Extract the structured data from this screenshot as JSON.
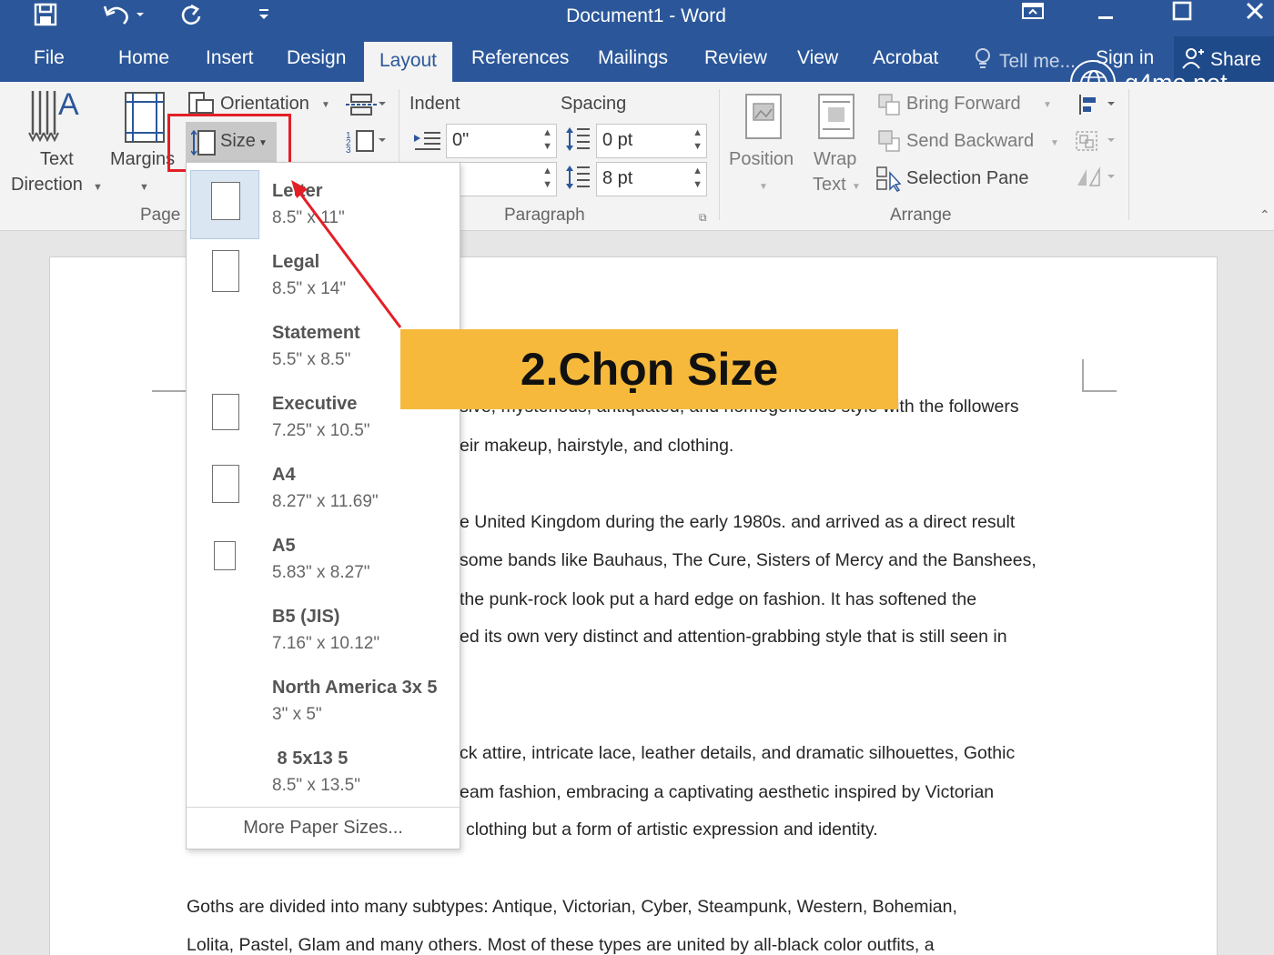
{
  "window": {
    "title": "Document1 - Word"
  },
  "tabs": [
    "File",
    "Home",
    "Insert",
    "Design",
    "Layout",
    "References",
    "Mailings",
    "Review",
    "View",
    "Acrobat"
  ],
  "active_tab": "Layout",
  "tell_me": "Tell me...",
  "signin": "Sign in",
  "share": "Share",
  "watermark": "g4me.net",
  "ribbon": {
    "text_direction": [
      "Text",
      "Direction"
    ],
    "margins": "Margins",
    "orientation": "Orientation",
    "size": "Size",
    "page_group": "Page",
    "indent_label": "Indent",
    "spacing_label": "Spacing",
    "indent_left": "0\"",
    "indent_right": "\"",
    "spacing_before": "0 pt",
    "spacing_after": "8 pt",
    "paragraph_group": "Paragraph",
    "position": "Position",
    "wrap": [
      "Wrap",
      "Text"
    ],
    "bring_forward": "Bring Forward",
    "send_backward": "Send Backward",
    "selection_pane": "Selection Pane",
    "arrange_group": "Arrange"
  },
  "size_menu": {
    "items": [
      {
        "name": "Letter",
        "dims": "8.5\" x 11\""
      },
      {
        "name": "Legal",
        "dims": "8.5\" x 14\""
      },
      {
        "name": "Statement",
        "dims": "5.5\" x 8.5\""
      },
      {
        "name": "Executive",
        "dims": "7.25\" x 10.5\""
      },
      {
        "name": "A4",
        "dims": "8.27\" x 11.69\""
      },
      {
        "name": "A5",
        "dims": "5.83\" x 8.27\""
      },
      {
        "name": "B5 (JIS)",
        "dims": "7.16\" x 10.12\""
      },
      {
        "name": "North America 3x 5",
        "dims": "3\" x 5\""
      },
      {
        "name": " 8 5x13 5",
        "dims": "8.5\" x 13.5\""
      }
    ],
    "more": "More Paper Sizes..."
  },
  "callout": "2.Chọn Size",
  "document": {
    "lines": [
      "sive, mysterious, antiquated, and homogeneous style with the followers",
      "eir makeup, hairstyle, and clothing.",
      "e United Kingdom during the early 1980s. and arrived as a direct result",
      "some bands like Bauhaus, The Cure, Sisters of Mercy and the Banshees,",
      "the punk-rock look put a hard edge on fashion. It has softened the",
      "ed its own very distinct and attention-grabbing style that is still seen in",
      "ck attire, intricate lace, leather details, and dramatic silhouettes, Gothic",
      "eam fashion, embracing a captivating aesthetic inspired by Victorian",
      "clothing but a form of artistic expression and identity.",
      "Goths are divided into many subtypes: Antique, Victorian, Cyber, Steampunk, Western, Bohemian,",
      "Lolita, Pastel, Glam and many others. Most of these types are united by all-black color outfits, a"
    ]
  },
  "colors": {
    "word_blue": "#2b579a",
    "highlight_red": "#e31f26",
    "callout_yellow": "#f6b93b"
  }
}
